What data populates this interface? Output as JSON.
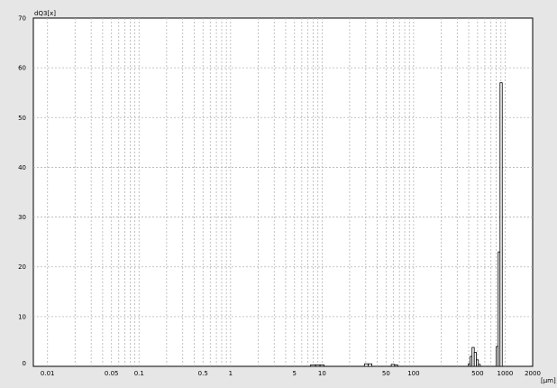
{
  "chart_data": {
    "type": "bar",
    "ylabel": "dQ3[x]",
    "xunit": "[µm]",
    "x_scale": "log",
    "xlim": [
      0.007,
      2000
    ],
    "ylim": [
      0,
      70
    ],
    "y_ticks": [
      0,
      10,
      20,
      30,
      40,
      50,
      60,
      70
    ],
    "x_tick_labels": [
      {
        "value": 0.01,
        "label": "0.01"
      },
      {
        "value": 0.05,
        "label": "0.05"
      },
      {
        "value": 0.1,
        "label": "0.1"
      },
      {
        "value": 0.5,
        "label": "0.5"
      },
      {
        "value": 1,
        "label": "1"
      },
      {
        "value": 5,
        "label": "5"
      },
      {
        "value": 10,
        "label": "10"
      },
      {
        "value": 50,
        "label": "50"
      },
      {
        "value": 100,
        "label": "100"
      },
      {
        "value": 500,
        "label": "500"
      },
      {
        "value": 1000,
        "label": "1000"
      },
      {
        "value": 2000,
        "label": "2000"
      }
    ],
    "x_gridlines": [
      0.01,
      0.02,
      0.03,
      0.04,
      0.05,
      0.06,
      0.07,
      0.08,
      0.09,
      0.1,
      0.2,
      0.3,
      0.4,
      0.5,
      0.6,
      0.7,
      0.8,
      0.9,
      1,
      2,
      3,
      4,
      5,
      6,
      7,
      8,
      9,
      10,
      20,
      30,
      40,
      50,
      60,
      70,
      80,
      90,
      100,
      200,
      300,
      400,
      500,
      600,
      700,
      800,
      900,
      1000,
      2000
    ],
    "grid": true,
    "bars": [
      {
        "x0": 7.5,
        "x1": 8.5,
        "value": 0.3
      },
      {
        "x0": 8.5,
        "x1": 9.5,
        "value": 0.3
      },
      {
        "x0": 9.5,
        "x1": 10.5,
        "value": 0.3
      },
      {
        "x0": 29,
        "x1": 32,
        "value": 0.5
      },
      {
        "x0": 32,
        "x1": 35,
        "value": 0.5
      },
      {
        "x0": 57,
        "x1": 62,
        "value": 0.4
      },
      {
        "x0": 62,
        "x1": 67,
        "value": 0.3
      },
      {
        "x0": 395,
        "x1": 415,
        "value": 0.5
      },
      {
        "x0": 415,
        "x1": 435,
        "value": 2.0
      },
      {
        "x0": 435,
        "x1": 460,
        "value": 3.8
      },
      {
        "x0": 460,
        "x1": 485,
        "value": 2.8
      },
      {
        "x0": 485,
        "x1": 510,
        "value": 1.3
      },
      {
        "x0": 510,
        "x1": 535,
        "value": 0.4
      },
      {
        "x0": 800,
        "x1": 840,
        "value": 4.0
      },
      {
        "x0": 840,
        "x1": 880,
        "value": 23.0
      },
      {
        "x0": 880,
        "x1": 930,
        "value": 57.0
      }
    ],
    "colors": {
      "bar_fill": "#ffffff",
      "bar_stroke": "#000000",
      "grid": "#b4b4b4",
      "plot_bg": "#ffffff",
      "frame_bg": "#e6e6e6"
    }
  }
}
